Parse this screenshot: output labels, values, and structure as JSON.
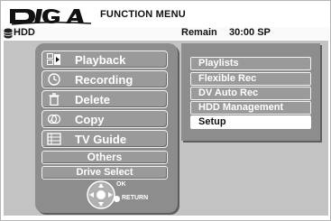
{
  "header": {
    "brand": "DIGA",
    "title": "FUNCTION MENU",
    "drive": "HDD",
    "remain_label": "Remain",
    "remain_value": "30:00 SP"
  },
  "main_menu": {
    "items": [
      {
        "label": "Playback",
        "icon": "playback-icon"
      },
      {
        "label": "Recording",
        "icon": "clock-icon"
      },
      {
        "label": "Delete",
        "icon": "trash-icon"
      },
      {
        "label": "Copy",
        "icon": "copy-icon"
      },
      {
        "label": "TV Guide",
        "icon": "guide-icon"
      }
    ],
    "others_label": "Others",
    "drive_select_label": "Drive Select"
  },
  "sub_menu": {
    "items": [
      "Playlists",
      "Flexible Rec",
      "DV Auto Rec",
      "HDD Management",
      "Setup"
    ],
    "selected": "Setup"
  },
  "remote_hint": {
    "ok_label": "OK",
    "return_label": "RETURN"
  },
  "colors": {
    "panel": "#8d8d8d",
    "background_area": "#c3c3c3",
    "selected_item": "#ffffff"
  }
}
